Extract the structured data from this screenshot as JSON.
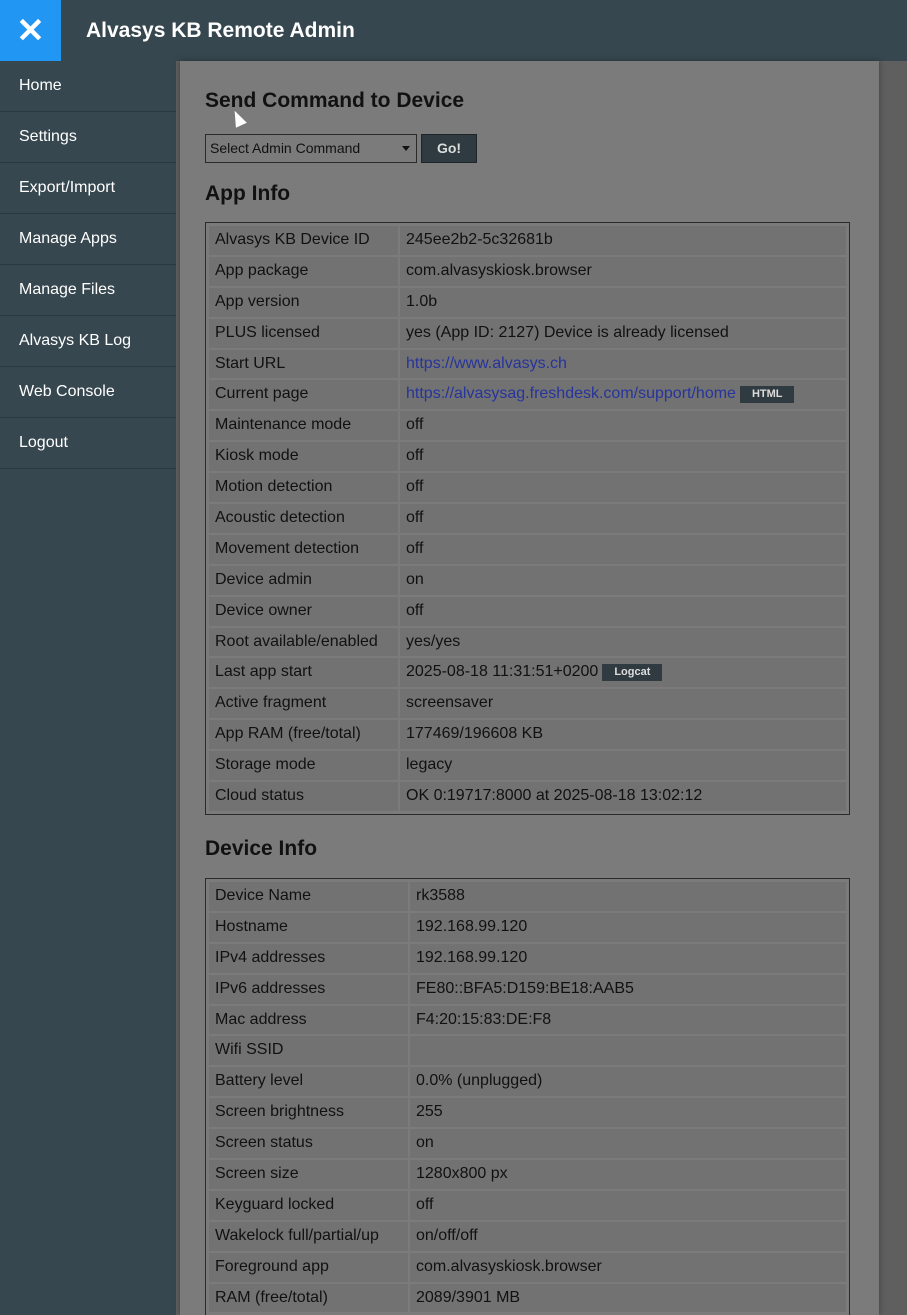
{
  "header": {
    "close_symbol": "✕",
    "title": "Alvasys KB Remote Admin"
  },
  "sidebar": {
    "items": [
      "Home",
      "Settings",
      "Export/Import",
      "Manage Apps",
      "Manage Files",
      "Alvasys KB Log",
      "Web Console",
      "Logout"
    ]
  },
  "command": {
    "heading": "Send Command to Device",
    "select_value": "Select Admin Command",
    "go_label": "Go!"
  },
  "app_info": {
    "heading": "App Info",
    "rows": [
      [
        "Alvasys KB Device ID",
        "245ee2b2-5c32681b"
      ],
      [
        "App package",
        "com.alvasyskiosk.browser"
      ],
      [
        "App version",
        "1.0b"
      ],
      [
        "PLUS licensed",
        "yes (App ID: 2127) Device is already licensed"
      ],
      [
        "Start URL",
        "https://www.alvasys.ch"
      ],
      [
        "Current page",
        "https://alvasysag.freshdesk.com/support/home"
      ],
      [
        "Maintenance mode",
        "off"
      ],
      [
        "Kiosk mode",
        "off"
      ],
      [
        "Motion detection",
        "off"
      ],
      [
        "Acoustic detection",
        "off"
      ],
      [
        "Movement detection",
        "off"
      ],
      [
        "Device admin",
        "on"
      ],
      [
        "Device owner",
        "off"
      ],
      [
        "Root available/enabled",
        "yes/yes"
      ],
      [
        "Last app start",
        "2025-08-18 11:31:51+0200"
      ],
      [
        "Active fragment",
        "screensaver"
      ],
      [
        "App RAM (free/total)",
        "177469/196608 KB"
      ],
      [
        "Storage mode",
        "legacy"
      ],
      [
        "Cloud status",
        "OK 0:19717:8000 at 2025-08-18 13:02:12"
      ]
    ],
    "html_button": "HTML",
    "logcat_button": "Logcat"
  },
  "device_info": {
    "heading": "Device Info",
    "rows": [
      [
        "Device Name",
        "rk3588"
      ],
      [
        "Hostname",
        "192.168.99.120"
      ],
      [
        "IPv4 addresses",
        "192.168.99.120"
      ],
      [
        "IPv6 addresses",
        "FE80::BFA5:D159:BE18:AAB5"
      ],
      [
        "Mac address",
        "F4:20:15:83:DE:F8"
      ],
      [
        "Wifi SSID",
        ""
      ],
      [
        "Battery level",
        "0.0% (unplugged)"
      ],
      [
        "Screen brightness",
        "255"
      ],
      [
        "Screen status",
        "on"
      ],
      [
        "Screen size",
        "1280x800 px"
      ],
      [
        "Keyguard locked",
        "off"
      ],
      [
        "Wakelock full/partial/up",
        "on/off/off"
      ],
      [
        "Foreground app",
        "com.alvasyskiosk.browser"
      ],
      [
        "RAM (free/total)",
        "2089/3901 MB"
      ]
    ]
  }
}
